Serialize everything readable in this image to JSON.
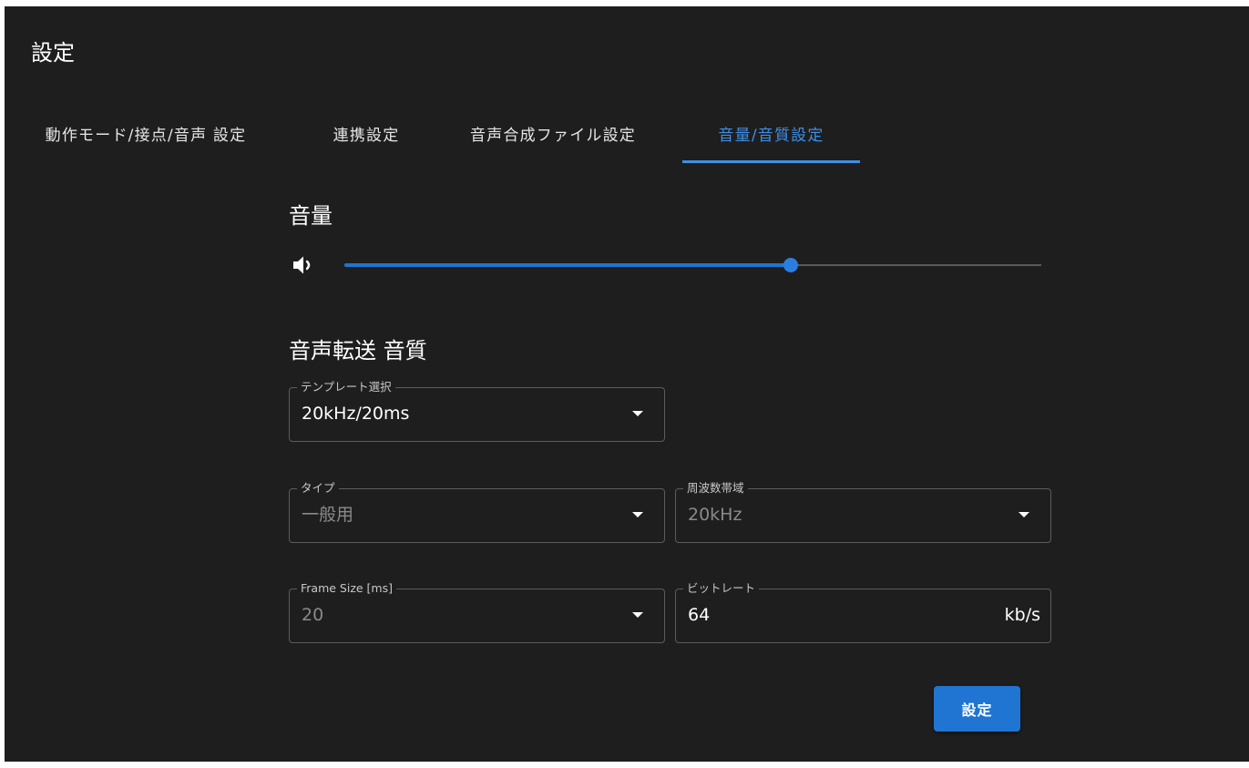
{
  "dialog": {
    "title": "設定"
  },
  "tabs": [
    {
      "label": "動作モード/接点/音声 設定",
      "active": false
    },
    {
      "label": "連携設定",
      "active": false
    },
    {
      "label": "音声合成ファイル設定",
      "active": false
    },
    {
      "label": "音量/音質設定",
      "active": true
    }
  ],
  "volume": {
    "heading": "音量",
    "icon": "volume-icon",
    "level": 0.64
  },
  "quality": {
    "heading": "音声転送 音質",
    "template": {
      "label": "テンプレート選択",
      "value": "20kHz/20ms"
    },
    "type": {
      "label": "タイプ",
      "value": "一般用",
      "disabled": true
    },
    "bandwidth": {
      "label": "周波数帯域",
      "value": "20kHz",
      "disabled": true
    },
    "frame_size": {
      "label": "Frame Size [ms]",
      "value": "20",
      "disabled": true
    },
    "bitrate": {
      "label": "ビットレート",
      "value": "64",
      "unit": "kb/s"
    }
  },
  "actions": {
    "submit_label": "設定"
  },
  "colors": {
    "background": "#1e1e1e",
    "accent": "#1f75d1",
    "tab_active": "#3f8fe6"
  }
}
